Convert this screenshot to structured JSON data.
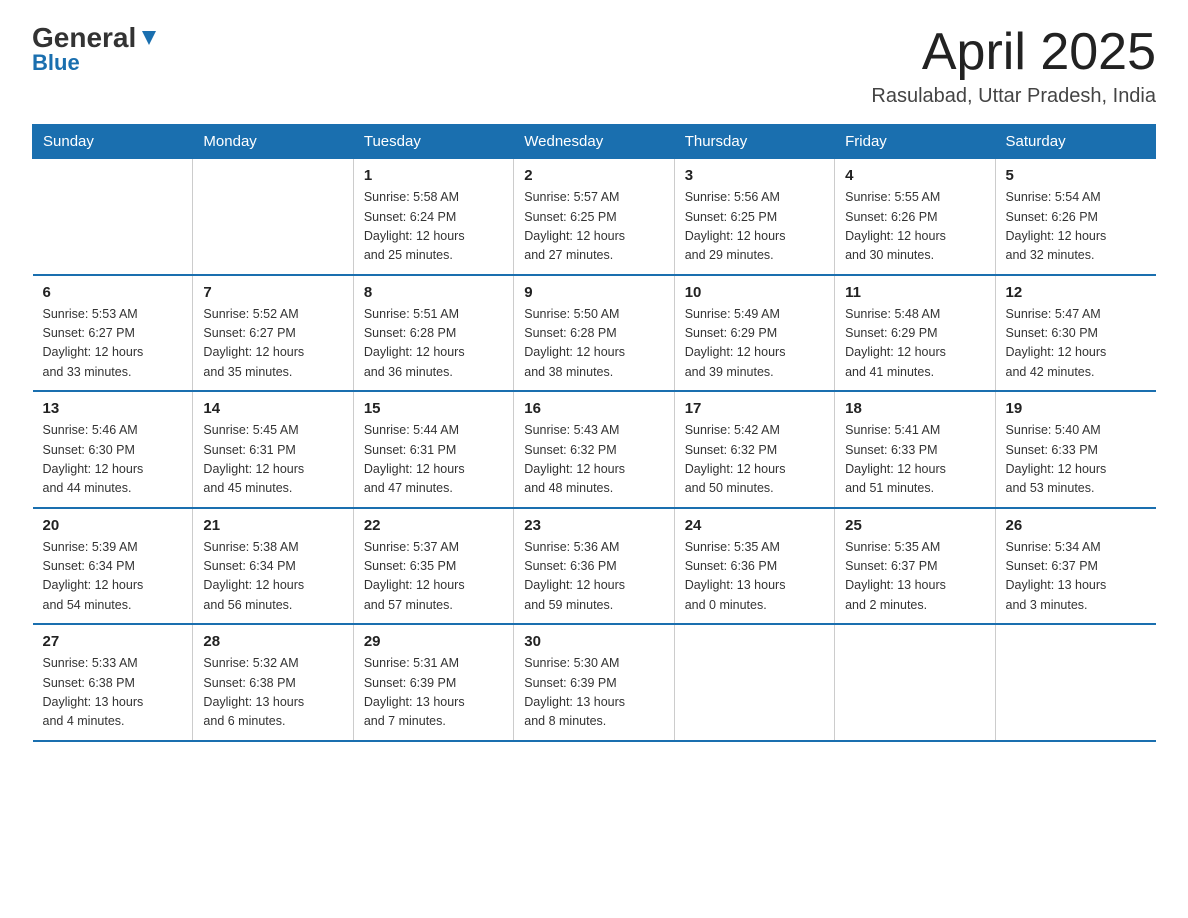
{
  "header": {
    "logo_general": "General",
    "logo_blue": "Blue",
    "month": "April 2025",
    "location": "Rasulabad, Uttar Pradesh, India"
  },
  "days_of_week": [
    "Sunday",
    "Monday",
    "Tuesday",
    "Wednesday",
    "Thursday",
    "Friday",
    "Saturday"
  ],
  "weeks": [
    [
      {
        "day": "",
        "info": ""
      },
      {
        "day": "",
        "info": ""
      },
      {
        "day": "1",
        "info": "Sunrise: 5:58 AM\nSunset: 6:24 PM\nDaylight: 12 hours\nand 25 minutes."
      },
      {
        "day": "2",
        "info": "Sunrise: 5:57 AM\nSunset: 6:25 PM\nDaylight: 12 hours\nand 27 minutes."
      },
      {
        "day": "3",
        "info": "Sunrise: 5:56 AM\nSunset: 6:25 PM\nDaylight: 12 hours\nand 29 minutes."
      },
      {
        "day": "4",
        "info": "Sunrise: 5:55 AM\nSunset: 6:26 PM\nDaylight: 12 hours\nand 30 minutes."
      },
      {
        "day": "5",
        "info": "Sunrise: 5:54 AM\nSunset: 6:26 PM\nDaylight: 12 hours\nand 32 minutes."
      }
    ],
    [
      {
        "day": "6",
        "info": "Sunrise: 5:53 AM\nSunset: 6:27 PM\nDaylight: 12 hours\nand 33 minutes."
      },
      {
        "day": "7",
        "info": "Sunrise: 5:52 AM\nSunset: 6:27 PM\nDaylight: 12 hours\nand 35 minutes."
      },
      {
        "day": "8",
        "info": "Sunrise: 5:51 AM\nSunset: 6:28 PM\nDaylight: 12 hours\nand 36 minutes."
      },
      {
        "day": "9",
        "info": "Sunrise: 5:50 AM\nSunset: 6:28 PM\nDaylight: 12 hours\nand 38 minutes."
      },
      {
        "day": "10",
        "info": "Sunrise: 5:49 AM\nSunset: 6:29 PM\nDaylight: 12 hours\nand 39 minutes."
      },
      {
        "day": "11",
        "info": "Sunrise: 5:48 AM\nSunset: 6:29 PM\nDaylight: 12 hours\nand 41 minutes."
      },
      {
        "day": "12",
        "info": "Sunrise: 5:47 AM\nSunset: 6:30 PM\nDaylight: 12 hours\nand 42 minutes."
      }
    ],
    [
      {
        "day": "13",
        "info": "Sunrise: 5:46 AM\nSunset: 6:30 PM\nDaylight: 12 hours\nand 44 minutes."
      },
      {
        "day": "14",
        "info": "Sunrise: 5:45 AM\nSunset: 6:31 PM\nDaylight: 12 hours\nand 45 minutes."
      },
      {
        "day": "15",
        "info": "Sunrise: 5:44 AM\nSunset: 6:31 PM\nDaylight: 12 hours\nand 47 minutes."
      },
      {
        "day": "16",
        "info": "Sunrise: 5:43 AM\nSunset: 6:32 PM\nDaylight: 12 hours\nand 48 minutes."
      },
      {
        "day": "17",
        "info": "Sunrise: 5:42 AM\nSunset: 6:32 PM\nDaylight: 12 hours\nand 50 minutes."
      },
      {
        "day": "18",
        "info": "Sunrise: 5:41 AM\nSunset: 6:33 PM\nDaylight: 12 hours\nand 51 minutes."
      },
      {
        "day": "19",
        "info": "Sunrise: 5:40 AM\nSunset: 6:33 PM\nDaylight: 12 hours\nand 53 minutes."
      }
    ],
    [
      {
        "day": "20",
        "info": "Sunrise: 5:39 AM\nSunset: 6:34 PM\nDaylight: 12 hours\nand 54 minutes."
      },
      {
        "day": "21",
        "info": "Sunrise: 5:38 AM\nSunset: 6:34 PM\nDaylight: 12 hours\nand 56 minutes."
      },
      {
        "day": "22",
        "info": "Sunrise: 5:37 AM\nSunset: 6:35 PM\nDaylight: 12 hours\nand 57 minutes."
      },
      {
        "day": "23",
        "info": "Sunrise: 5:36 AM\nSunset: 6:36 PM\nDaylight: 12 hours\nand 59 minutes."
      },
      {
        "day": "24",
        "info": "Sunrise: 5:35 AM\nSunset: 6:36 PM\nDaylight: 13 hours\nand 0 minutes."
      },
      {
        "day": "25",
        "info": "Sunrise: 5:35 AM\nSunset: 6:37 PM\nDaylight: 13 hours\nand 2 minutes."
      },
      {
        "day": "26",
        "info": "Sunrise: 5:34 AM\nSunset: 6:37 PM\nDaylight: 13 hours\nand 3 minutes."
      }
    ],
    [
      {
        "day": "27",
        "info": "Sunrise: 5:33 AM\nSunset: 6:38 PM\nDaylight: 13 hours\nand 4 minutes."
      },
      {
        "day": "28",
        "info": "Sunrise: 5:32 AM\nSunset: 6:38 PM\nDaylight: 13 hours\nand 6 minutes."
      },
      {
        "day": "29",
        "info": "Sunrise: 5:31 AM\nSunset: 6:39 PM\nDaylight: 13 hours\nand 7 minutes."
      },
      {
        "day": "30",
        "info": "Sunrise: 5:30 AM\nSunset: 6:39 PM\nDaylight: 13 hours\nand 8 minutes."
      },
      {
        "day": "",
        "info": ""
      },
      {
        "day": "",
        "info": ""
      },
      {
        "day": "",
        "info": ""
      }
    ]
  ]
}
